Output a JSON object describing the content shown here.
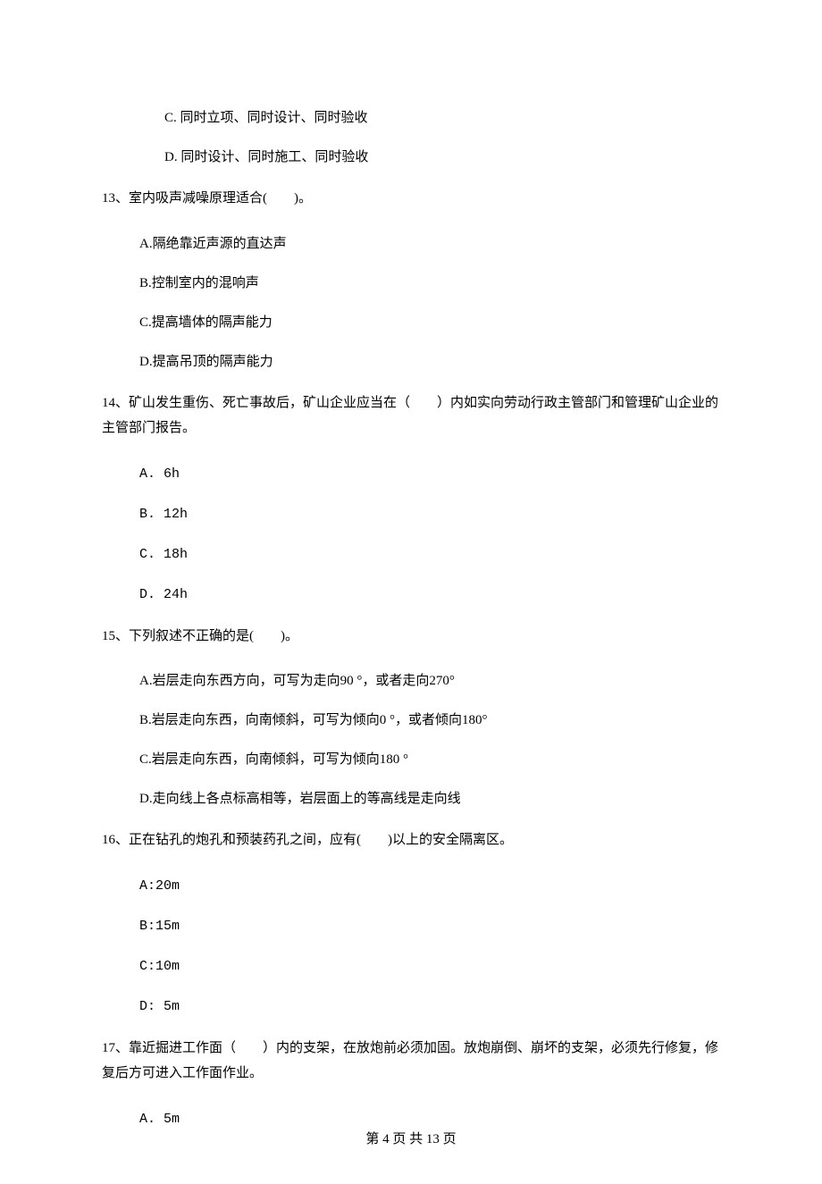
{
  "prev_options": {
    "c": "C. 同时立项、同时设计、同时验收",
    "d": "D. 同时设计、同时施工、同时验收"
  },
  "q13": {
    "text": "13、室内吸声减噪原理适合(　　)。",
    "a": "A.隔绝靠近声源的直达声",
    "b": "B.控制室内的混响声",
    "c": "C.提高墙体的隔声能力",
    "d": "D.提高吊顶的隔声能力"
  },
  "q14": {
    "text": "14、矿山发生重伤、死亡事故后，矿山企业应当在（　　）内如实向劳动行政主管部门和管理矿山企业的主管部门报告。",
    "a": "A. 6h",
    "b": "B. 12h",
    "c": "C. 18h",
    "d": "D. 24h"
  },
  "q15": {
    "text": "15、下列叙述不正确的是(　　)。",
    "a": "A.岩层走向东西方向，可写为走向90 °，或者走向270°",
    "b": "B.岩层走向东西，向南倾斜，可写为倾向0 °，或者倾向180°",
    "c": "C.岩层走向东西，向南倾斜，可写为倾向180 °",
    "d": "D.走向线上各点标高相等，岩层面上的等高线是走向线"
  },
  "q16": {
    "text": "16、正在钻孔的炮孔和预装药孔之间，应有(　　)以上的安全隔离区。",
    "a": "A:20m",
    "b": "B:15m",
    "c": "C:10m",
    "d": "D: 5m"
  },
  "q17": {
    "text": "17、靠近掘进工作面（　　）内的支架，在放炮前必须加固。放炮崩倒、崩坏的支架，必须先行修复，修复后方可进入工作面作业。",
    "a": "A. 5m"
  },
  "footer": "第 4 页 共 13 页"
}
